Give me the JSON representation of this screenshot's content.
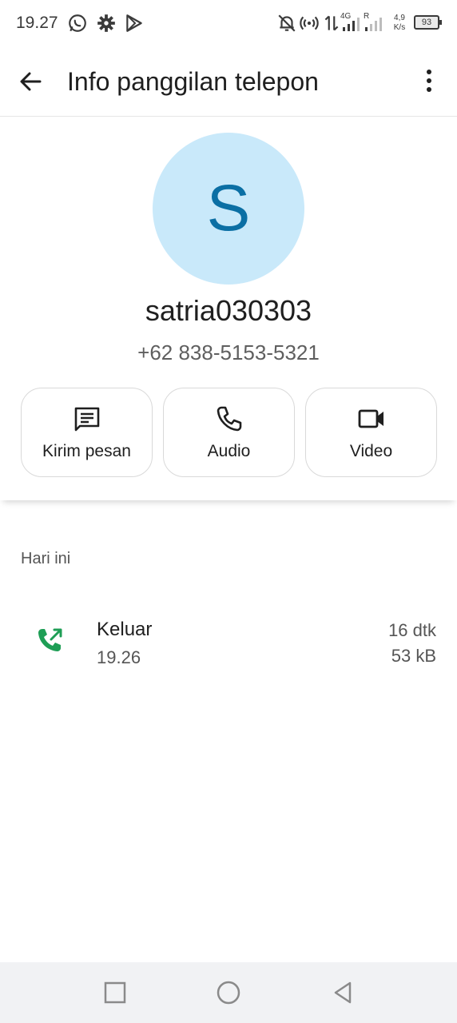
{
  "status_bar": {
    "time": "19.27",
    "icons": [
      "whatsapp-icon",
      "settings-gear-icon",
      "play-store-icon",
      "notifications-off-icon",
      "hotspot-icon",
      "data-arrows-icon",
      "signal-4g-icon",
      "signal-roaming-icon"
    ],
    "network_type": "4G",
    "roaming": "R",
    "speed_value": "4,9",
    "speed_unit": "K/s",
    "battery": "93"
  },
  "app_bar": {
    "title": "Info panggilan telepon",
    "back_icon": "arrow-back-icon",
    "more_icon": "more-vert-icon"
  },
  "contact": {
    "avatar_letter": "S",
    "name": "satria030303",
    "number": "+62 838-5153-5321",
    "actions": [
      {
        "label": "Kirim pesan",
        "icon": "message-icon"
      },
      {
        "label": "Audio",
        "icon": "phone-icon"
      },
      {
        "label": "Video",
        "icon": "videocam-icon"
      }
    ]
  },
  "history": {
    "section_label": "Hari ini",
    "calls": [
      {
        "type": "Keluar",
        "time": "19.26",
        "duration": "16 dtk",
        "size": "53 kB",
        "icon": "outgoing-call-icon"
      }
    ]
  },
  "nav_bar": {
    "buttons": [
      "recents-square-icon",
      "home-circle-icon",
      "back-triangle-icon"
    ]
  },
  "colors": {
    "avatar_bg": "#c9e9fa",
    "avatar_fg": "#0b6fa4",
    "call_green": "#1e9e55",
    "nav_bg": "#f1f2f4"
  }
}
